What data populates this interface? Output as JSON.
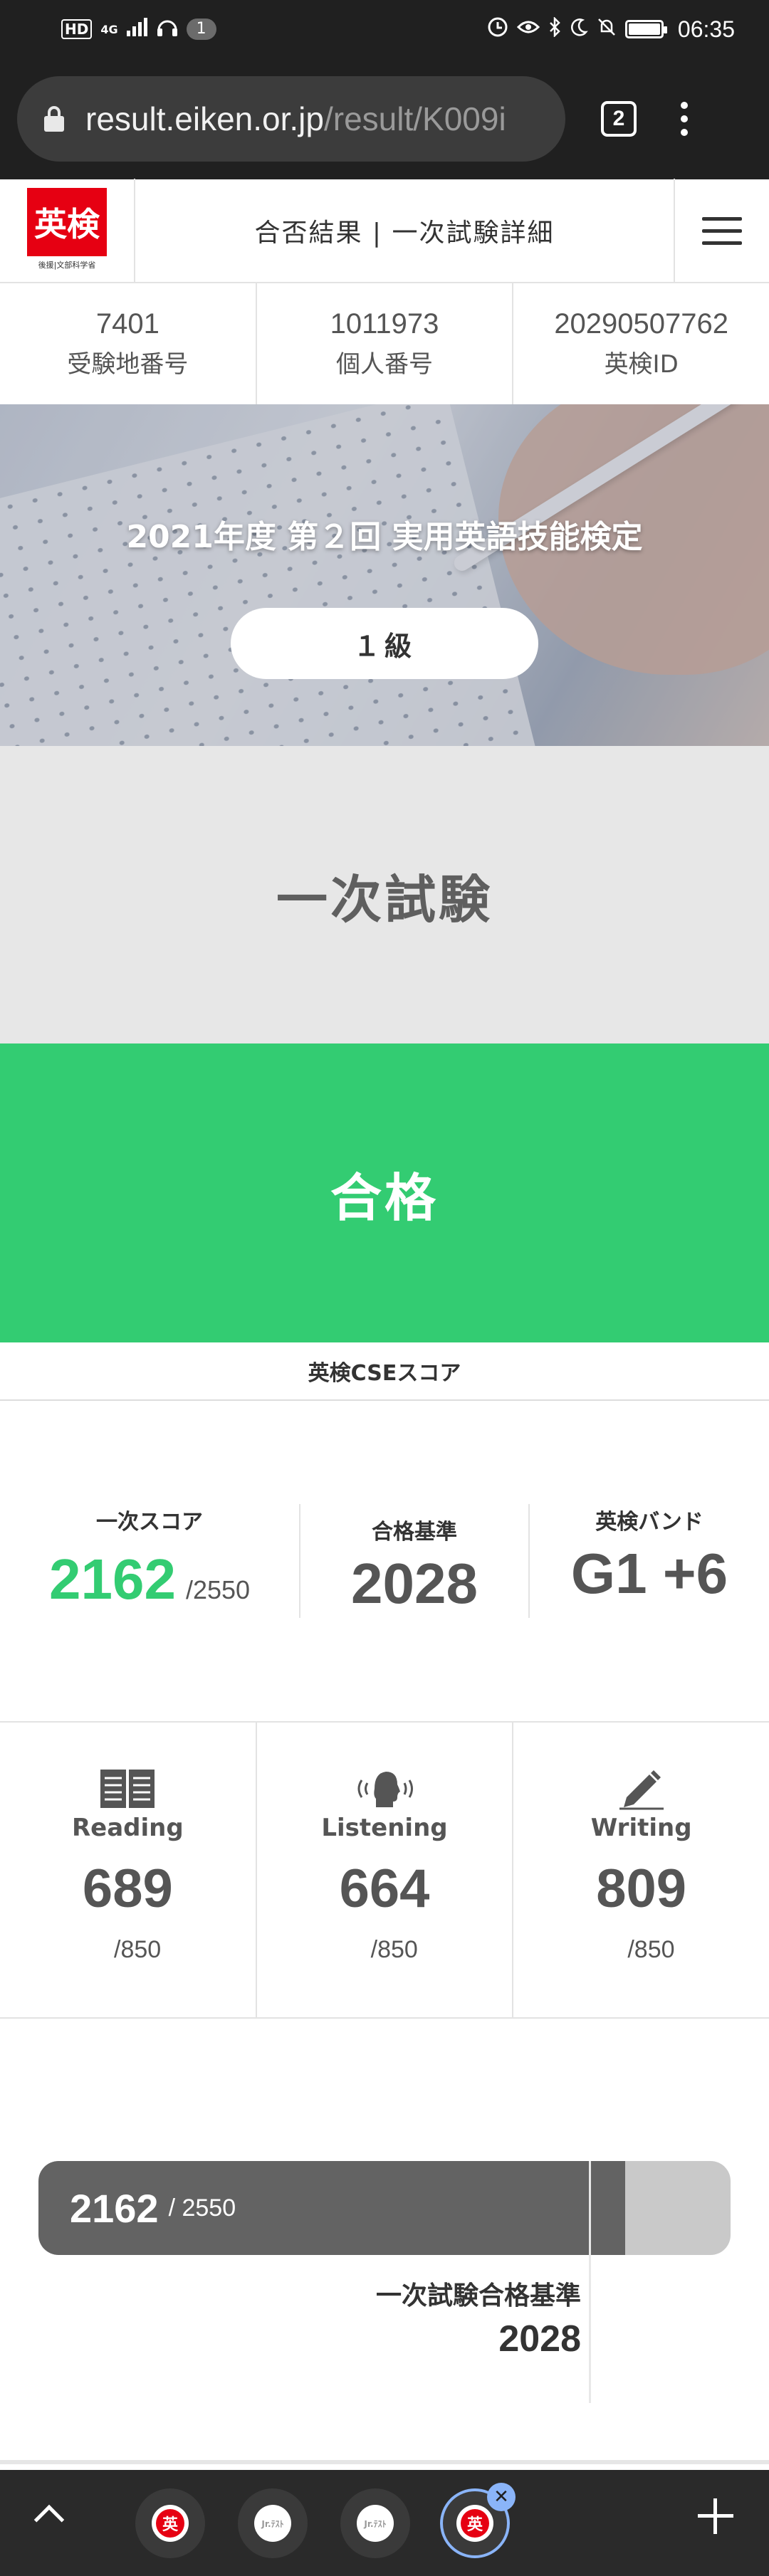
{
  "status_bar": {
    "left_badges": [
      "HD",
      "4G"
    ],
    "notification_count": "1",
    "time": "06:35"
  },
  "browser": {
    "url_host": "result.eiken.or.jp",
    "url_path": "/result/K009i",
    "tab_count": "2"
  },
  "header": {
    "logo_text": "英検",
    "logo_sub": "後援|文部科学省",
    "title": "合否結果 | 一次試験詳細"
  },
  "info": [
    {
      "value": "7401",
      "label": "受験地番号"
    },
    {
      "value": "1011973",
      "label": "個人番号"
    },
    {
      "value": "20290507762",
      "label": "英検ID"
    }
  ],
  "hero": {
    "title": "2021年度 第２回 実用英語技能検定",
    "grade": "１級"
  },
  "exam_band_title": "一次試験",
  "result_title": "合格",
  "cse_label": "英検CSEスコア",
  "summary": {
    "score_label": "一次スコア",
    "score": "2162",
    "score_max": "/2550",
    "pass_label": "合格基準",
    "pass_score": "2028",
    "band_label": "英検バンド",
    "band": "G1 +6"
  },
  "skills": [
    {
      "icon": "book-icon",
      "name": "Reading",
      "score": "689",
      "max": "/850"
    },
    {
      "icon": "listening-head-icon",
      "name": "Listening",
      "score": "664",
      "max": "/850"
    },
    {
      "icon": "pencil-icon",
      "name": "Writing",
      "score": "809",
      "max": "/850"
    }
  ],
  "progress": {
    "score": "2162",
    "max_label": "/ 2550",
    "score_value": 2162,
    "max_value": 2550,
    "threshold_value": 2028,
    "threshold_label": "一次試験合格基準",
    "threshold_text": "2028"
  },
  "tab_strip": {
    "tabs": [
      {
        "favicon": "eiken-favicon",
        "text": "英"
      },
      {
        "favicon": "site-favicon",
        "text": "Jr.ﾃｽﾄ"
      },
      {
        "favicon": "site-favicon",
        "text": "Jr.ﾃｽﾄ"
      },
      {
        "favicon": "eiken-favicon",
        "text": "英",
        "active": true
      }
    ]
  },
  "colors": {
    "accent_green": "#33cc72",
    "logo_red": "#e60012",
    "bar_fill": "#636363",
    "bar_track": "#c9c9c9"
  }
}
